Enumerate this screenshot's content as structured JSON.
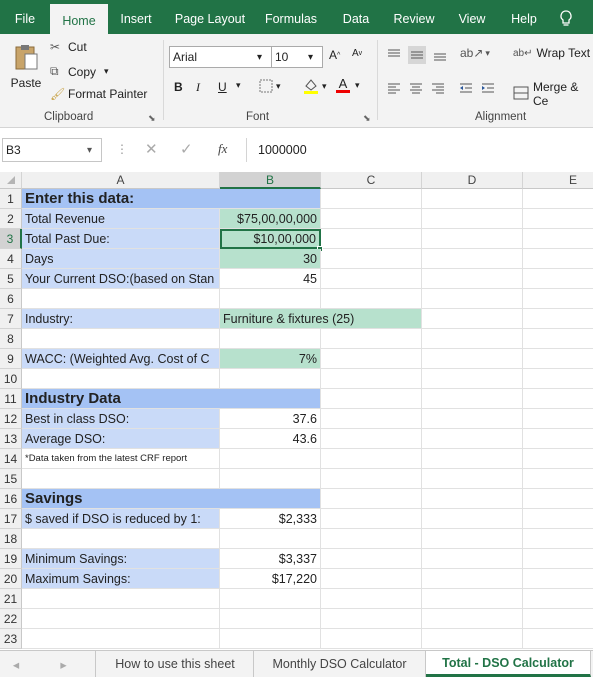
{
  "ribbon_tabs": [
    "File",
    "Home",
    "Insert",
    "Page Layout",
    "Formulas",
    "Data",
    "Review",
    "View",
    "Help"
  ],
  "clipboard": {
    "paste": "Paste",
    "cut": "Cut",
    "copy": "Copy",
    "format_painter": "Format Painter",
    "label": "Clipboard"
  },
  "font": {
    "name": "Arial",
    "size": "10",
    "label": "Font",
    "bold": "B",
    "italic": "I",
    "underline": "U"
  },
  "alignment": {
    "wrap_text": "Wrap Text",
    "merge": "Merge & Ce",
    "label": "Alignment"
  },
  "formula_bar": {
    "name_box": "B3",
    "fx": "fx",
    "value": "1000000"
  },
  "columns": [
    "A",
    "B",
    "C",
    "D",
    "E"
  ],
  "rows": [
    "1",
    "2",
    "3",
    "4",
    "5",
    "6",
    "7",
    "8",
    "9",
    "10",
    "11",
    "12",
    "13",
    "14",
    "15",
    "16",
    "17",
    "18",
    "19",
    "20",
    "21",
    "22",
    "23"
  ],
  "cells": {
    "a1": "Enter this data:",
    "a2": "Total Revenue",
    "b2": "$75,00,00,000",
    "a3": "Total Past Due:",
    "b3": "$10,00,000",
    "a4": "Days",
    "b4": "30",
    "a5": "Your Current DSO:(based on Stan",
    "b5": "45",
    "a7": "Industry:",
    "b7": "Furniture & fixtures (25)",
    "a9": "WACC:  (Weighted Avg. Cost of C",
    "b9": "7%",
    "a11": "Industry Data",
    "a12": "Best in class DSO:",
    "b12": "37.6",
    "a13": "Average DSO:",
    "b13": "43.6",
    "a14": "*Data taken from the latest CRF report",
    "a16": "Savings",
    "a17": "$ saved if DSO is reduced by 1:",
    "b17": "$2,333",
    "a19": "Minimum Savings:",
    "b19": "$3,337",
    "a20": "Maximum Savings:",
    "b20": "$17,220"
  },
  "sheet_tabs": [
    "How to use this sheet",
    "Monthly DSO Calculator",
    "Total - DSO Calculator"
  ],
  "colors": {
    "accent": "#217346",
    "input_blue": "#c9daf8",
    "header_blue": "#a4c2f4",
    "input_green": "#b7e1cd"
  }
}
